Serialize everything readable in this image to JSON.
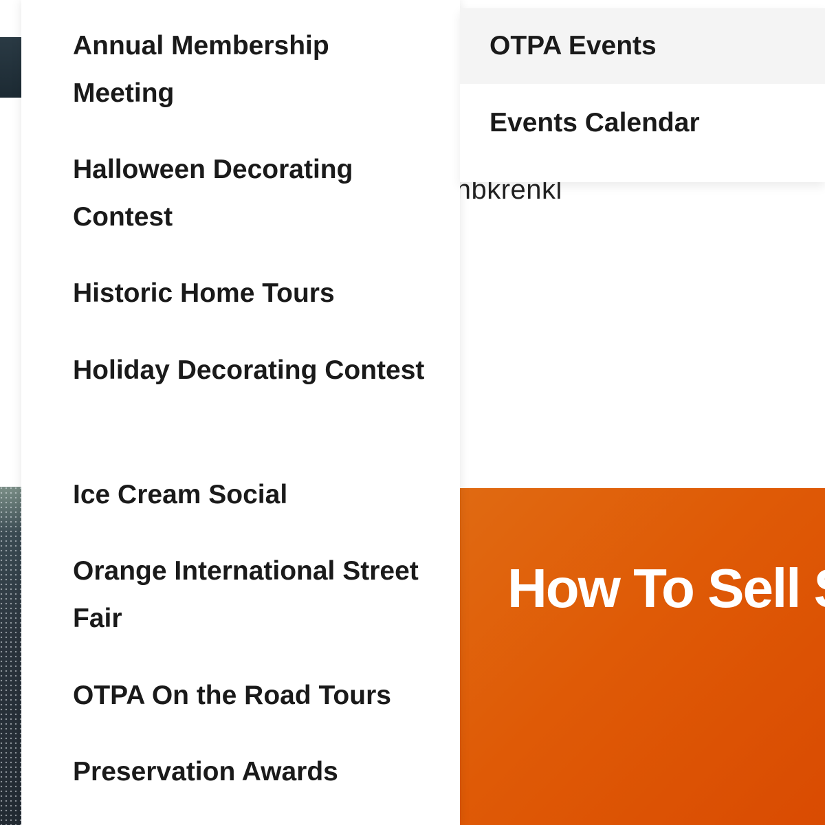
{
  "submenu": {
    "items": [
      {
        "label": "Annual Membership Meeting"
      },
      {
        "label": "Halloween Decorating Contest"
      },
      {
        "label": "Historic Home Tours"
      },
      {
        "label": "Holiday Decorating Contest"
      },
      {
        "label": "Ice Cream Social"
      },
      {
        "label": "Orange International Street Fair"
      },
      {
        "label": "OTPA On the Road Tours"
      },
      {
        "label": "Preservation Awards"
      }
    ]
  },
  "mainmenu": {
    "items": [
      {
        "label": "OTPA Events",
        "active": true
      },
      {
        "label": "Events Calendar",
        "active": false
      }
    ]
  },
  "background": {
    "author_text": "ghbkrenkl",
    "hero_title": "How To Sell S",
    "hero_color": "#df5a06"
  }
}
